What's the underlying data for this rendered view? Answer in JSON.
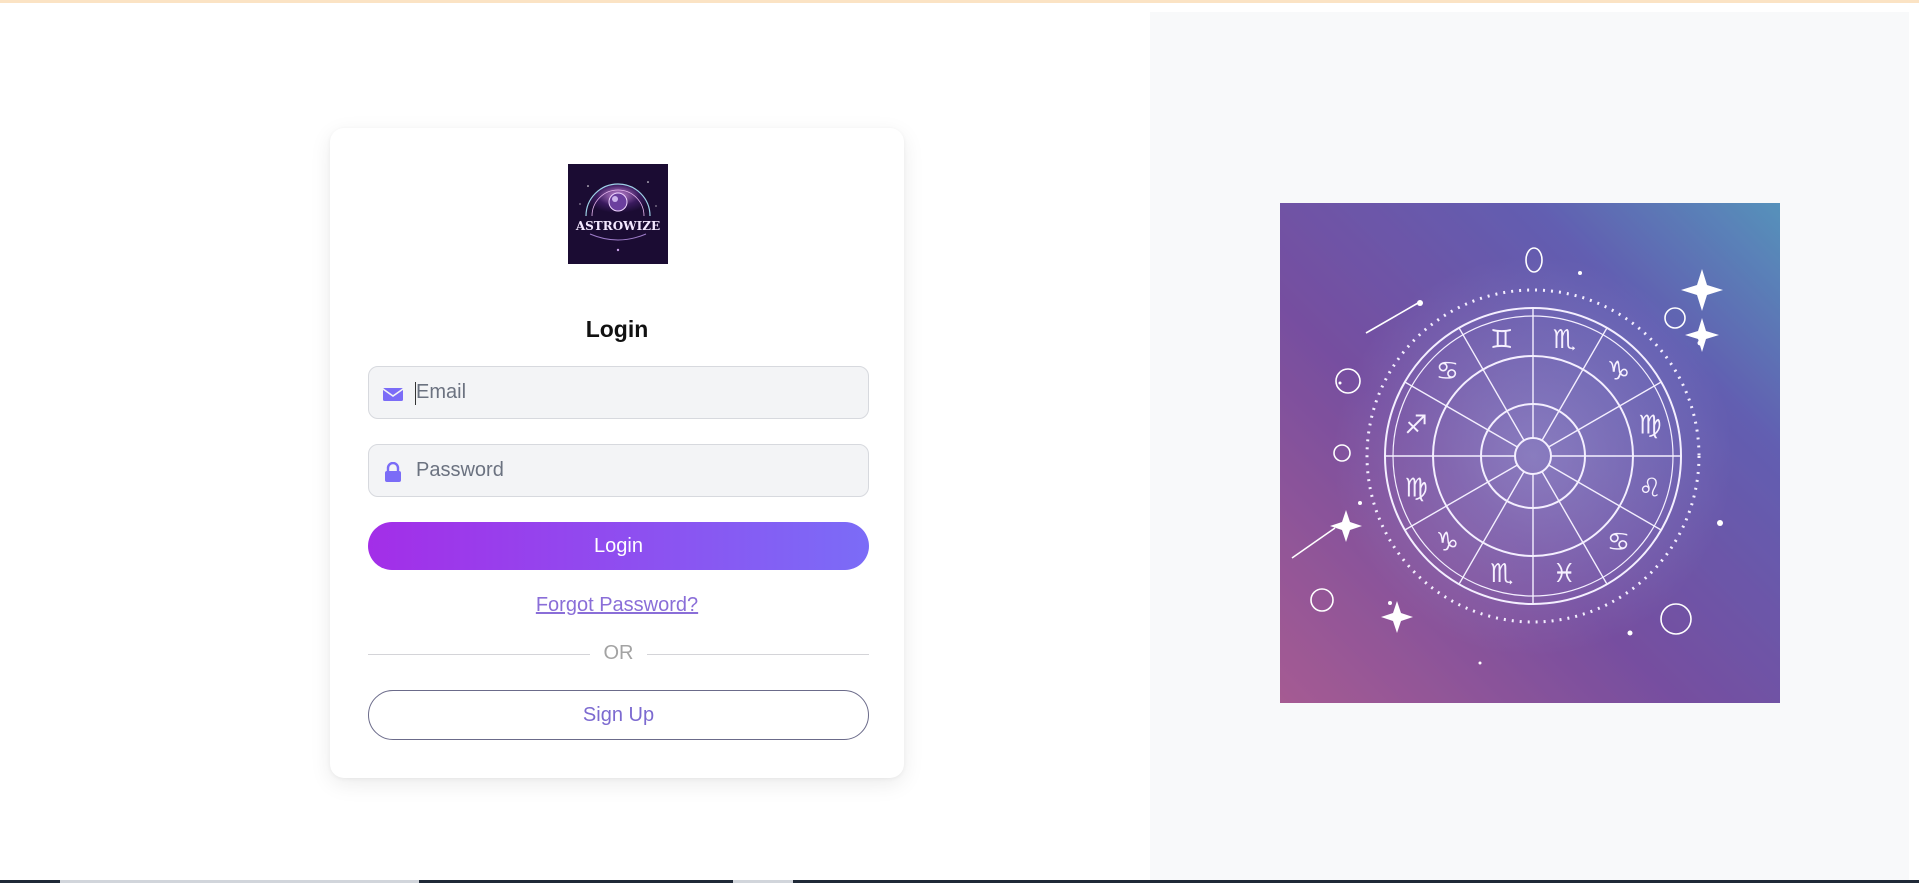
{
  "login_card": {
    "logo_text": "ASTROWIZE",
    "title": "Login",
    "email": {
      "placeholder": "Email",
      "icon": "envelope-icon",
      "value": ""
    },
    "password": {
      "placeholder": "Password",
      "icon": "lock-icon",
      "value": ""
    },
    "login_label": "Login",
    "forgot_label": "Forgot Password?",
    "divider_label": "OR",
    "signup_label": "Sign Up"
  },
  "hero_image": {
    "subject": "zodiac wheel illustration",
    "glyphs": [
      "♏",
      "♑",
      "♍",
      "♌",
      "♋",
      "♓",
      "♏",
      "♑",
      "♍",
      "♐",
      "♋",
      "♊"
    ]
  },
  "colors": {
    "accent_start": "#a32ee8",
    "accent_end": "#7b6cf7",
    "link": "#8a6ed8",
    "icon": "#7b6cf7"
  }
}
